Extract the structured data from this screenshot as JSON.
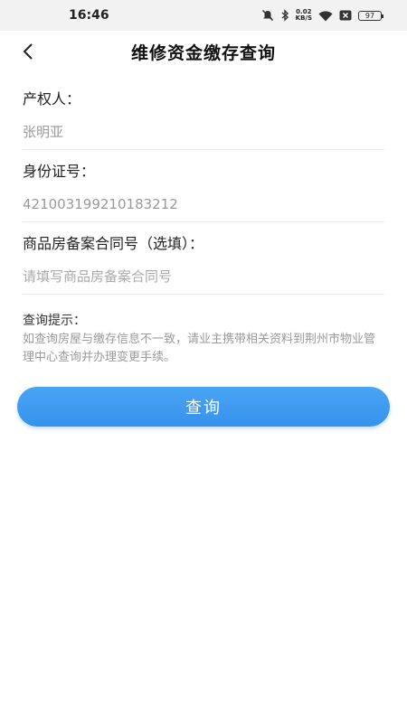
{
  "status_bar": {
    "time": "16:46",
    "net_speed_value": "0.02",
    "net_speed_unit": "KB/S",
    "battery": "97",
    "icons": [
      "mute-icon",
      "bluetooth-icon",
      "wifi-icon",
      "sim-off-icon",
      "battery-icon"
    ]
  },
  "header": {
    "title": "维修资金缴存查询",
    "back_icon": "chevron-left-icon"
  },
  "form": {
    "owner_label": "产权人：",
    "owner_value": "张明亚",
    "id_label": "身份证号：",
    "id_value": "421003199210183212",
    "contract_label": "商品房备案合同号（选填）：",
    "contract_placeholder": "请填写商品房备案合同号"
  },
  "tips": {
    "title": "查询提示：",
    "text": "如查询房屋与缴存信息不一致，请业主携带相关资料到荆州市物业管理中心查询并办理变更手续。"
  },
  "actions": {
    "submit_label": "查询"
  },
  "colors": {
    "accent": "#3d98ef",
    "status_bar_bg": "#f2f2f2"
  }
}
